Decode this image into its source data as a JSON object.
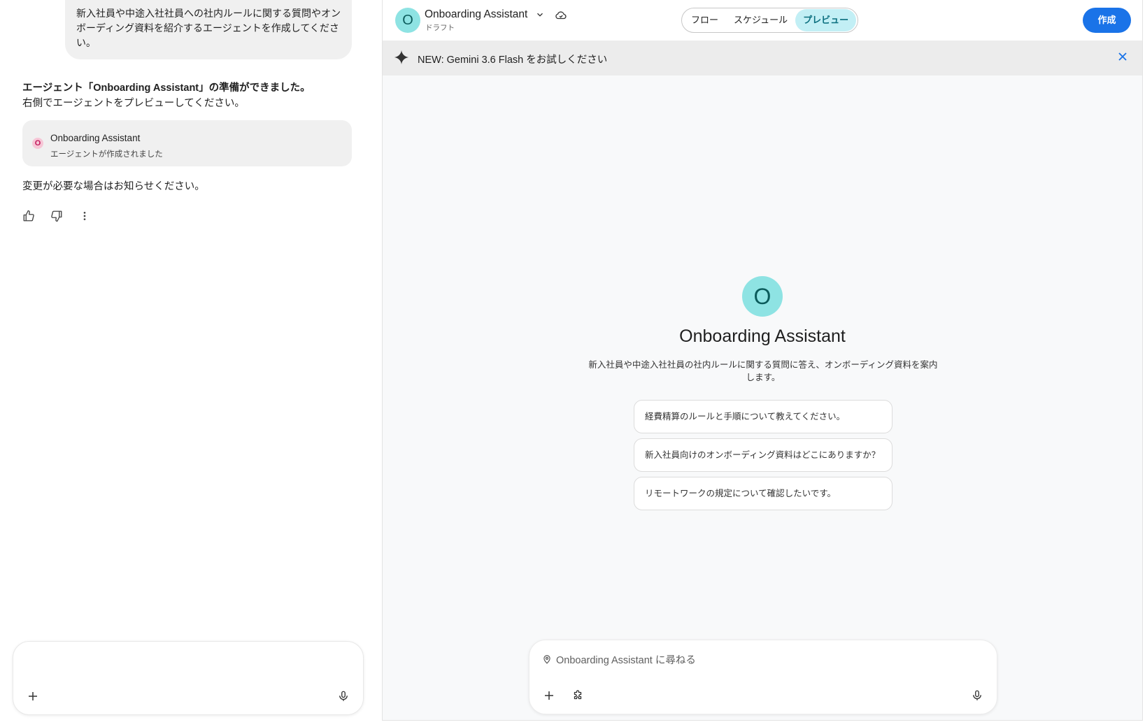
{
  "chat": {
    "user_message": "新入社員や中途入社社員への社内ルールに関する質問やオンボーディング資料を紹介するエージェントを作成してください。",
    "reply_title": "エージェント「Onboarding Assistant」の準備ができました。",
    "reply_subtitle": "右側でエージェントをプレビューしてください。",
    "agent_card": {
      "initial": "O",
      "name": "Onboarding Assistant",
      "status": "エージェントが作成されました"
    },
    "follow_up": "変更が必要な場合はお知らせください。",
    "feedback_icons": [
      "thumbs-up-icon",
      "thumbs-down-icon",
      "more-vert-icon"
    ],
    "composer": {
      "value": "",
      "icons": [
        "plus-icon",
        "mic-icon"
      ]
    }
  },
  "preview": {
    "header": {
      "avatar_initial": "O",
      "agent_name": "Onboarding Assistant",
      "state": "ドラフト",
      "tabs": [
        {
          "label": "フロー",
          "active": false
        },
        {
          "label": "スケジュール",
          "active": false
        },
        {
          "label": "プレビュー",
          "active": true
        }
      ],
      "create_label": "作成"
    },
    "banner": {
      "text": "NEW: Gemini 3.6 Flash をお試しください"
    },
    "hero": {
      "initial": "O",
      "title": "Onboarding Assistant",
      "description": "新入社員や中途入社社員の社内ルールに関する質問に答え、オンボーディング資料を案内します。"
    },
    "suggestions": [
      "経費精算のルールと手順について教えてください。",
      "新入社員向けのオンボーディング資料はどこにありますか？",
      "リモートワークの規定について確認したいです。"
    ],
    "composer": {
      "placeholder": "Onboarding Assistant に尋ねる",
      "icons": [
        "location-pin-icon",
        "plus-icon",
        "extension-icon",
        "mic-icon"
      ]
    }
  },
  "colors": {
    "accent_blue": "#1a73e8",
    "avatar_teal": "#8ee3e3",
    "active_tab_bg": "#c2eff5",
    "agent_dot_pink": "#f6c6d6"
  }
}
